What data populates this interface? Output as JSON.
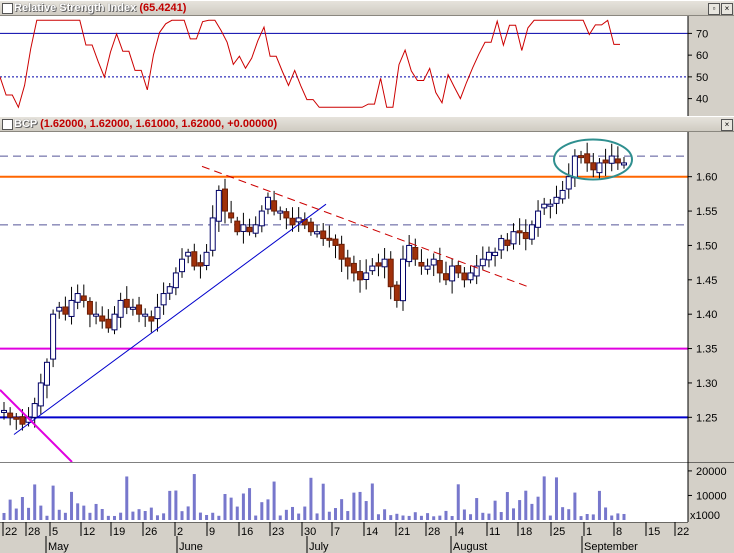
{
  "rsi_panel": {
    "title": "Relative Strength Index",
    "value": "(65.4241)",
    "y_ticks": [
      "70",
      "60",
      "50",
      "40"
    ]
  },
  "price_panel": {
    "title": "BCP",
    "ohlc_label": "(1.62000, 1.62000, 1.61000, 1.62000, +0.00000)",
    "y_ticks": [
      "1.60",
      "1.55",
      "1.50",
      "1.45",
      "1.40",
      "1.35",
      "1.30",
      "1.25"
    ]
  },
  "volume_panel": {
    "y_ticks": [
      "20000",
      "10000"
    ],
    "multiplier": "x1000"
  },
  "x_axis": {
    "day_labels": [
      "22",
      "28",
      "5",
      "12",
      "19",
      "26",
      "2",
      "9",
      "16",
      "23",
      "30",
      "7",
      "14",
      "21",
      "28",
      "4",
      "11",
      "18",
      "25",
      "1",
      "8",
      "15",
      "22"
    ],
    "month_labels": [
      "May",
      "June",
      "July",
      "August",
      "September"
    ]
  },
  "colors": {
    "rsi_line": "#cc0000",
    "up_candle": "#ffffff",
    "down_candle": "#a0300a",
    "resistance_orange": "#ff6600",
    "support_magenta": "#e000e0",
    "support_blue": "#0000cc",
    "trendline_red_dash": "#cc0000",
    "ellipse": "#2f8f8f",
    "volume_bar": "#7777cc"
  },
  "chart_data": {
    "type": "candlestick",
    "symbol": "BCP",
    "last": {
      "open": 1.62,
      "high": 1.62,
      "low": 1.61,
      "close": 1.62,
      "change": 0.0
    },
    "y_range": [
      1.185,
      1.665
    ],
    "ohlc_close_approx": [
      1.26,
      1.25,
      1.25,
      1.24,
      1.25,
      1.27,
      1.3,
      1.33,
      1.4,
      1.41,
      1.4,
      1.42,
      1.43,
      1.42,
      1.4,
      1.4,
      1.39,
      1.38,
      1.4,
      1.42,
      1.41,
      1.41,
      1.4,
      1.4,
      1.39,
      1.41,
      1.43,
      1.44,
      1.46,
      1.48,
      1.49,
      1.47,
      1.47,
      1.49,
      1.54,
      1.58,
      1.55,
      1.54,
      1.52,
      1.53,
      1.52,
      1.53,
      1.55,
      1.57,
      1.55,
      1.55,
      1.54,
      1.53,
      1.54,
      1.53,
      1.52,
      1.52,
      1.51,
      1.51,
      1.5,
      1.48,
      1.47,
      1.46,
      1.45,
      1.46,
      1.47,
      1.47,
      1.48,
      1.44,
      1.42,
      1.48,
      1.5,
      1.48,
      1.47,
      1.47,
      1.48,
      1.46,
      1.45,
      1.47,
      1.46,
      1.45,
      1.46,
      1.47,
      1.48,
      1.49,
      1.49,
      1.51,
      1.5,
      1.52,
      1.52,
      1.51,
      1.53,
      1.55,
      1.56,
      1.56,
      1.57,
      1.58,
      1.6,
      1.63,
      1.63,
      1.62,
      1.61,
      1.62,
      1.62,
      1.63,
      1.62,
      1.62
    ],
    "horizontal_levels": [
      1.6,
      1.35,
      1.25
    ],
    "dashed_levels": [
      1.63,
      1.53
    ],
    "rsi": {
      "current": 65.4241,
      "levels": [
        70,
        50
      ],
      "y_range": [
        32,
        78
      ]
    },
    "volume": {
      "y_range": [
        0,
        22000
      ],
      "unit": "x1000"
    }
  }
}
